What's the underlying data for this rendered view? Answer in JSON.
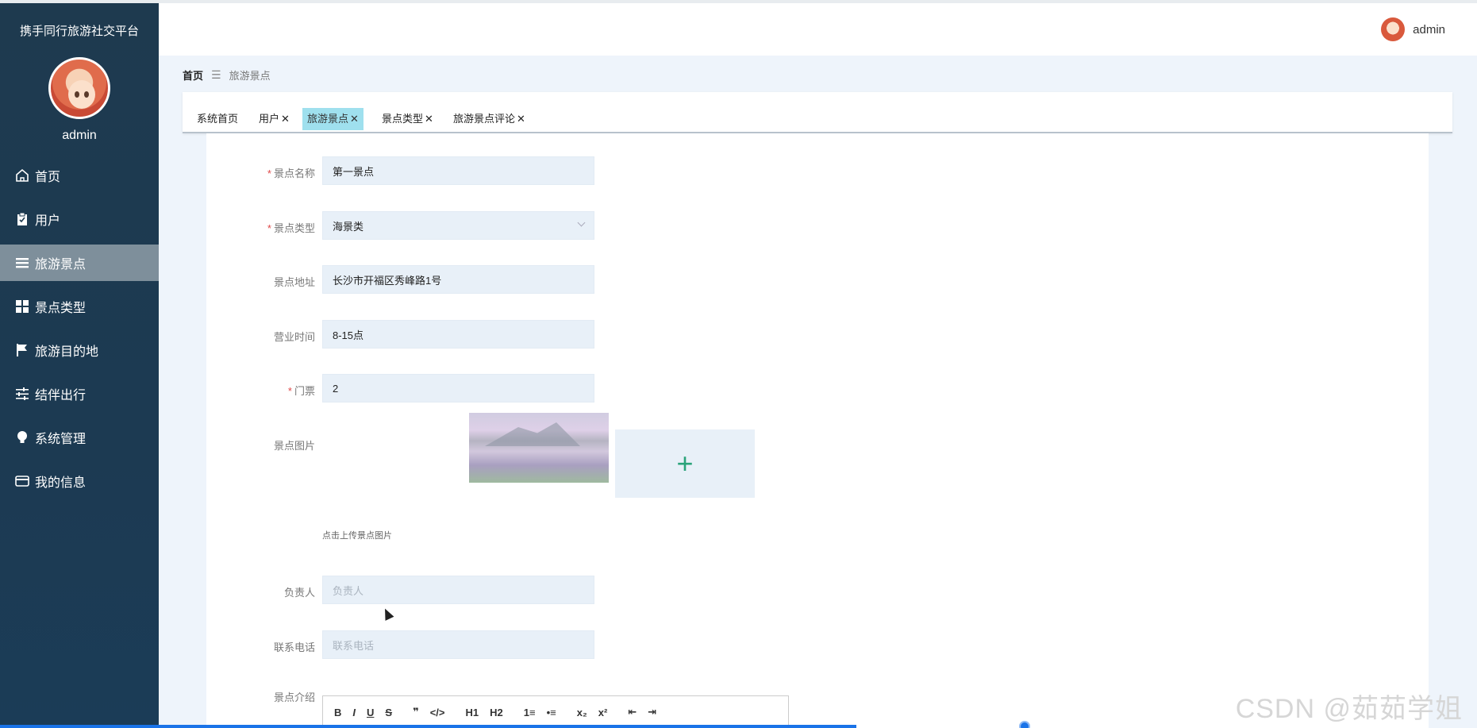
{
  "app": {
    "title": "携手同行旅游社交平台"
  },
  "sidebar": {
    "username": "admin",
    "items": [
      {
        "label": "首页",
        "icon": "home-icon"
      },
      {
        "label": "用户",
        "icon": "clipboard-icon"
      },
      {
        "label": "旅游景点",
        "icon": "list-icon",
        "active": true
      },
      {
        "label": "景点类型",
        "icon": "grid-icon"
      },
      {
        "label": "旅游目的地",
        "icon": "flag-icon"
      },
      {
        "label": "结伴出行",
        "icon": "sliders-icon"
      },
      {
        "label": "系统管理",
        "icon": "bulb-icon"
      },
      {
        "label": "我的信息",
        "icon": "wallet-icon"
      }
    ]
  },
  "header": {
    "username": "admin"
  },
  "breadcrumb": {
    "home": "首页",
    "current": "旅游景点"
  },
  "tabs": [
    {
      "label": "系统首页",
      "closable": false
    },
    {
      "label": "用户",
      "closable": true
    },
    {
      "label": "旅游景点",
      "closable": true,
      "active": true
    },
    {
      "label": "景点类型",
      "closable": true
    },
    {
      "label": "旅游景点评论",
      "closable": true
    }
  ],
  "form": {
    "name": {
      "label": "景点名称",
      "required": true,
      "value": "第一景点"
    },
    "type": {
      "label": "景点类型",
      "required": true,
      "value": "海景类"
    },
    "address": {
      "label": "景点地址",
      "value": "长沙市开福区秀峰路1号"
    },
    "hours": {
      "label": "营业时间",
      "value": "8-15点"
    },
    "ticket": {
      "label": "门票",
      "required": true,
      "value": "2"
    },
    "image": {
      "label": "景点图片",
      "hint": "点击上传景点图片"
    },
    "manager": {
      "label": "负责人",
      "placeholder": "负责人"
    },
    "phone": {
      "label": "联系电话",
      "placeholder": "联系电话"
    },
    "intro": {
      "label": "景点介绍"
    }
  },
  "editor_toolbar": [
    "B",
    "I",
    "U",
    "S",
    "❞",
    "</>",
    "H1",
    "H2",
    "1≡",
    "•≡",
    "x₂",
    "x²",
    "⇤",
    "⇥"
  ],
  "watermark": "CSDN @茹茹学姐",
  "colors": {
    "sidebar": "#1e3a4f",
    "active_tab": "#9fe0ee",
    "accent": "#2aa37a",
    "required": "#e04848"
  }
}
